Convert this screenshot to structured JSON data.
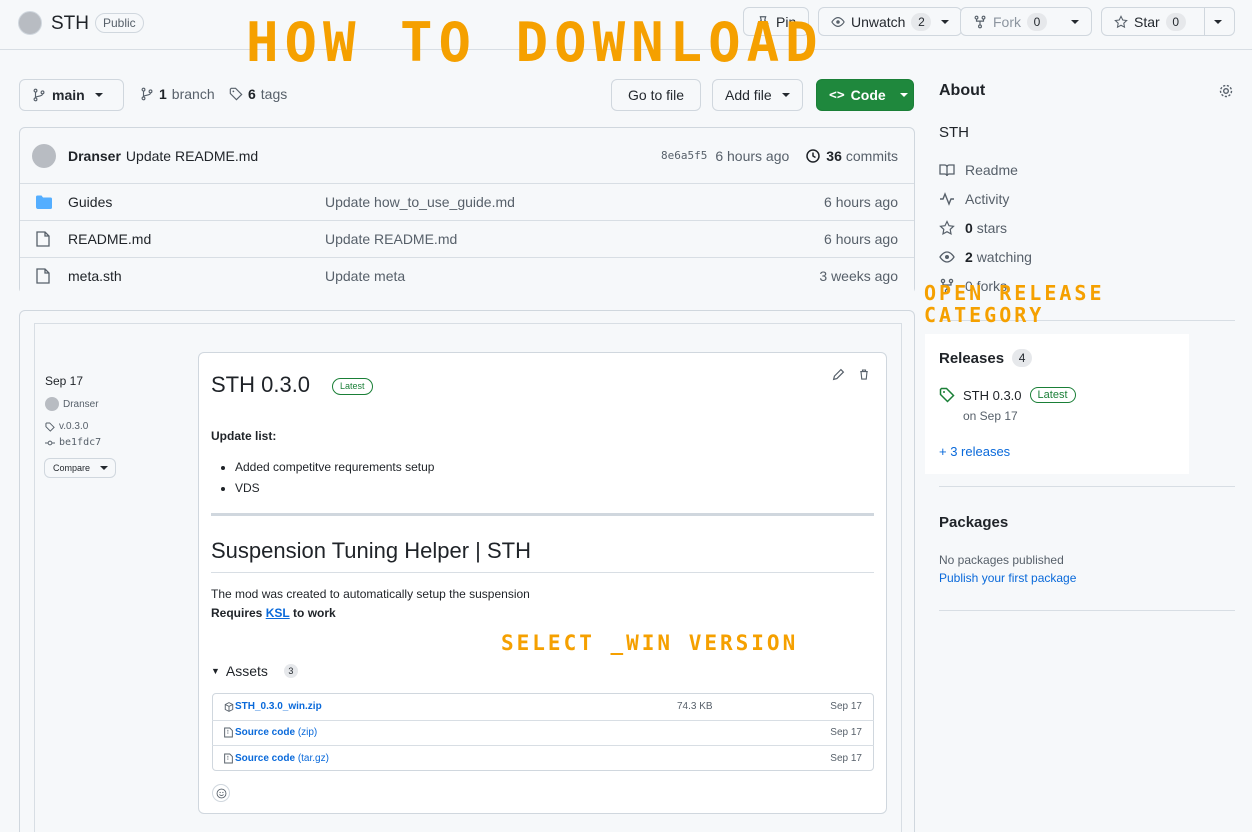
{
  "repo": {
    "name": "STH",
    "visibility": "Public",
    "pin_label": "Pin",
    "unwatch_label": "Unwatch",
    "unwatch_count": "2",
    "fork_label": "Fork",
    "fork_count": "0",
    "star_label": "Star",
    "star_count": "0"
  },
  "overlay": {
    "title": "HOW TO DOWNLOAD",
    "release_hint_line1": "OPEN RELEASE",
    "release_hint_line2": "CATEGORY",
    "win_hint": "SELECT _WIN VERSION",
    "color": "#f5a000"
  },
  "toolbar": {
    "branch": "main",
    "branch_count": "1",
    "branch_label": "branch",
    "tags_count": "6",
    "tags_label": "tags",
    "go_to_file": "Go to file",
    "add_file": "Add file",
    "code": "Code"
  },
  "commit": {
    "author": "Dranser",
    "message": "Update README.md",
    "hash": "8e6a5f5",
    "time": "6 hours ago",
    "commits_count": "36",
    "commits_label": "commits"
  },
  "files": [
    {
      "name": "Guides",
      "type": "folder",
      "message": "Update how_to_use_guide.md",
      "time": "6 hours ago"
    },
    {
      "name": "README.md",
      "type": "file",
      "message": "Update README.md",
      "time": "6 hours ago"
    },
    {
      "name": "meta.sth",
      "type": "file",
      "message": "Update meta",
      "time": "3 weeks ago"
    }
  ],
  "release_panel": {
    "date": "Sep 17",
    "author": "Dranser",
    "tag": "v.0.3.0",
    "commit": "be1fdc7",
    "compare": "Compare",
    "title": "STH 0.3.0",
    "latest": "Latest",
    "update_list_label": "Update list:",
    "updates": [
      "Added competitve requrements setup",
      "VDS"
    ],
    "heading": "Suspension Tuning Helper | STH",
    "description": "The mod was created to automatically setup the suspension",
    "requires_pre": "Requires",
    "requires_link": "KSL",
    "requires_post": "to work",
    "assets_label": "Assets",
    "assets_count": "3",
    "assets": [
      {
        "name": "STH_0.3.0_win.zip",
        "suffix": "",
        "size": "74.3 KB",
        "date": "Sep 17"
      },
      {
        "name": "Source code",
        "suffix": "(zip)",
        "size": "",
        "date": "Sep 17"
      },
      {
        "name": "Source code",
        "suffix": "(tar.gz)",
        "size": "",
        "date": "Sep 17"
      }
    ]
  },
  "sidebar": {
    "about": "About",
    "description": "STH",
    "readme": "Readme",
    "activity": "Activity",
    "stars_count": "0",
    "stars_label": "stars",
    "watching_count": "2",
    "watching_label": "watching",
    "forks_partial": "0 forks",
    "releases_label": "Releases",
    "releases_count": "4",
    "latest_release": "STH 0.3.0",
    "latest_badge": "Latest",
    "latest_date": "on Sep 17",
    "more_releases": "+ 3 releases",
    "packages_label": "Packages",
    "no_packages": "No packages published",
    "publish_package": "Publish your first package"
  }
}
